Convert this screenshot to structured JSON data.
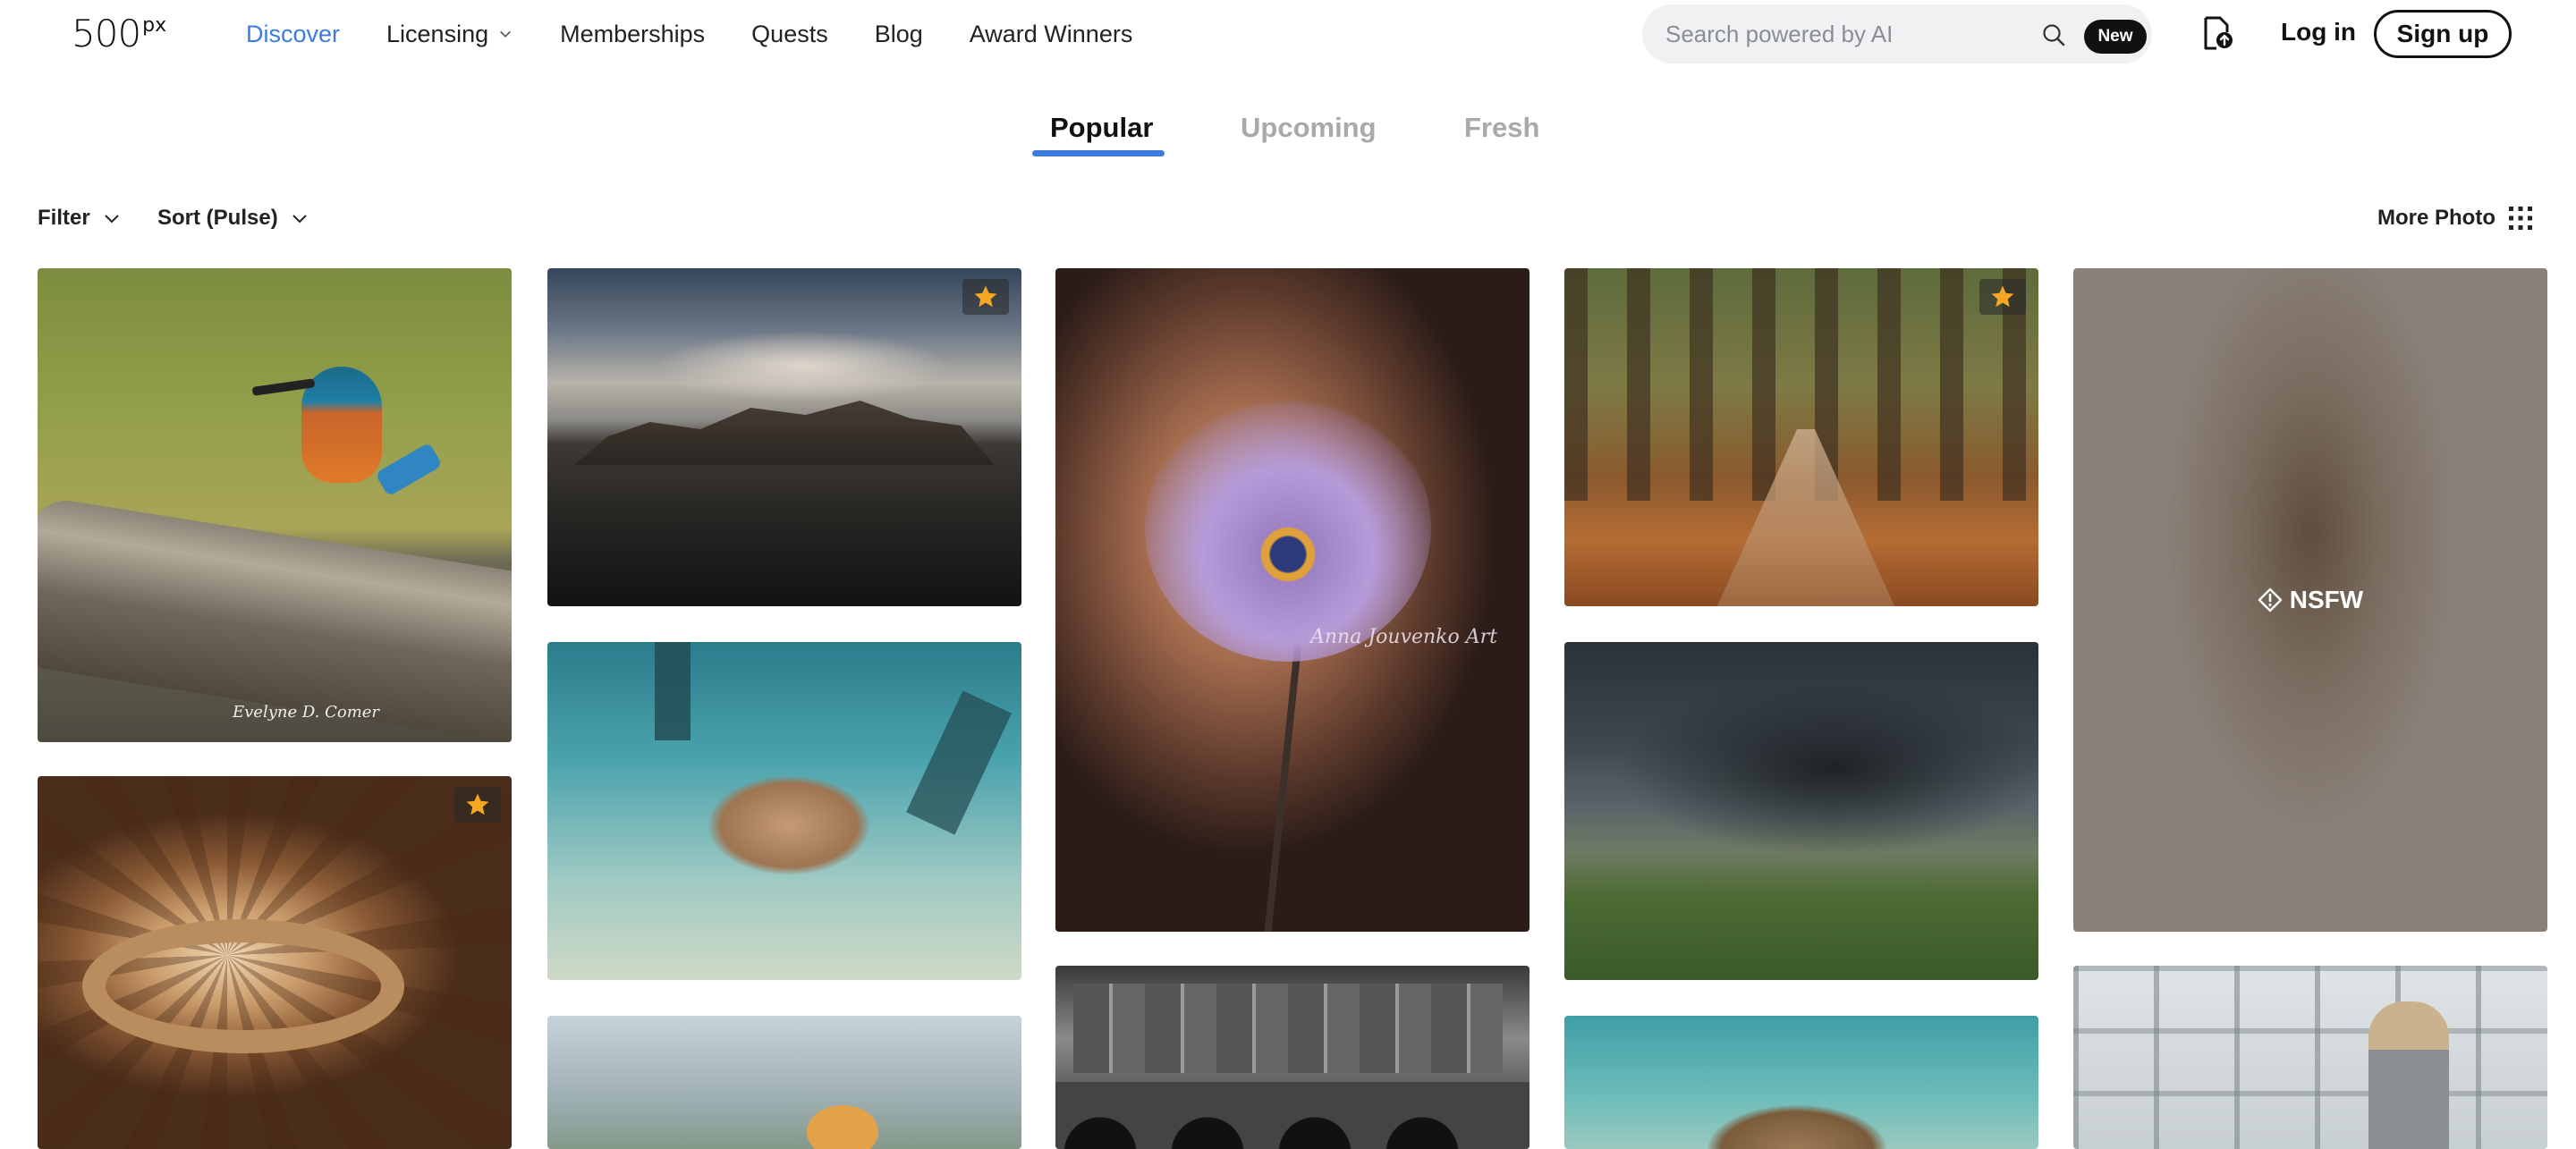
{
  "header": {
    "logo_main": "500",
    "logo_sup": "px",
    "nav": [
      {
        "label": "Discover",
        "active": true
      },
      {
        "label": "Licensing",
        "has_dropdown": true
      },
      {
        "label": "Memberships"
      },
      {
        "label": "Quests"
      },
      {
        "label": "Blog"
      },
      {
        "label": "Award Winners"
      }
    ],
    "search": {
      "placeholder": "Search powered by AI",
      "value": "",
      "badge": "New"
    },
    "login_label": "Log in",
    "signup_label": "Sign up"
  },
  "tabs": [
    {
      "label": "Popular",
      "active": true
    },
    {
      "label": "Upcoming",
      "active": false
    },
    {
      "label": "Fresh",
      "active": false
    }
  ],
  "filterbar": {
    "filter_label": "Filter",
    "sort_label": "Sort (Pulse)",
    "more_label": "More Photo"
  },
  "photos": [
    {
      "subject": "kingfisher on branch",
      "featured": false,
      "signature": "Evelyne D. Comer"
    },
    {
      "subject": "mountain above black sand beach",
      "featured": true
    },
    {
      "subject": "purple flower",
      "featured": false,
      "signature": "Anna Jouvenko Art"
    },
    {
      "subject": "autumn tree lane",
      "featured": true
    },
    {
      "subject": "blurred portrait",
      "featured": false,
      "nsfw_label": "NSFW"
    },
    {
      "subject": "spiral concrete staircase",
      "featured": true
    },
    {
      "subject": "sea turtle underwater",
      "featured": false
    },
    {
      "subject": "flower field",
      "featured": false
    },
    {
      "subject": "city canal bridge at night",
      "featured": false
    },
    {
      "subject": "storm over green hills",
      "featured": false
    },
    {
      "subject": "turtle underwater",
      "featured": false
    },
    {
      "subject": "woman by window",
      "featured": false
    }
  ],
  "colors": {
    "accent": "#3b7ce3",
    "featured_star": "#f5a623",
    "tab_inactive": "#a7a9ad"
  }
}
